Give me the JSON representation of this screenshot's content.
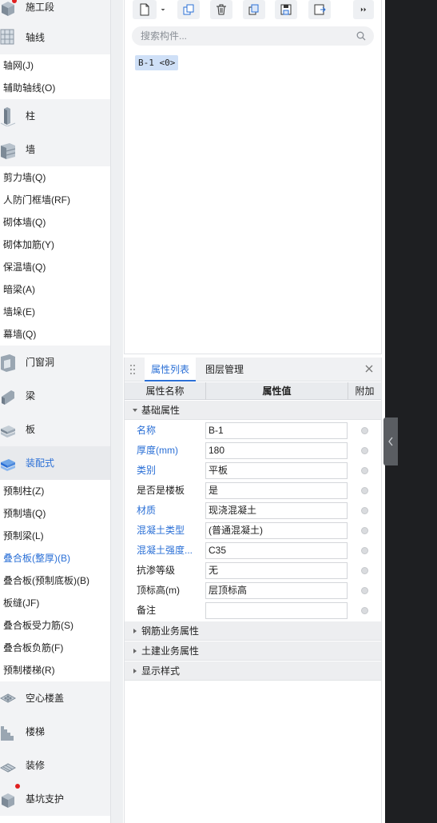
{
  "nav": {
    "cat_shigongduan": "施工段",
    "cat_zhouxian": "轴线",
    "sub_zhouwang": "轴网(J)",
    "sub_fuzhu_zhouxian": "辅助轴线(O)",
    "cat_zhu": "柱",
    "cat_qiang": "墙",
    "sub_jianliqiang": "剪力墙(Q)",
    "sub_renfang": "人防门框墙(RF)",
    "sub_qitiqiang": "砌体墙(Q)",
    "sub_qitijiajin": "砌体加筋(Y)",
    "sub_baowenqiang": "保温墙(Q)",
    "sub_anliang": "暗梁(A)",
    "sub_qiangduo": "墙垛(E)",
    "sub_muqiang": "幕墙(Q)",
    "cat_menchuangdong": "门窗洞",
    "cat_liang": "梁",
    "cat_ban": "板",
    "cat_zhuangpeishi": "装配式",
    "sub_yuzhizhu": "预制柱(Z)",
    "sub_yuzhiqiang": "预制墙(Q)",
    "sub_yuzhiliang": "预制梁(L)",
    "sub_diehe_zhenghou": "叠合板(整厚)(B)",
    "sub_diehe_yuzhi": "叠合板(预制底板)(B)",
    "sub_banfeng": "板缝(JF)",
    "sub_diehe_shouli": "叠合板受力筋(S)",
    "sub_diehe_fujin": "叠合板负筋(F)",
    "sub_yuzhi_louti": "预制楼梯(R)",
    "cat_kongxin": "空心楼盖",
    "cat_louti": "楼梯",
    "cat_zhuangxiu": "装修",
    "cat_jikeng": "基坑支护"
  },
  "component_list": {
    "search_placeholder": "搜索构件...",
    "items": [
      "B-1 <0>"
    ]
  },
  "property_panel": {
    "tab_properties": "属性列表",
    "tab_layers": "图层管理",
    "col_name": "属性名称",
    "col_value": "属性值",
    "col_extra": "附加",
    "group_basic": "基础属性",
    "rows": [
      {
        "name": "名称",
        "value": "B-1"
      },
      {
        "name": "厚度(mm)",
        "value": "180"
      },
      {
        "name": "类别",
        "value": "平板"
      },
      {
        "name": "是否是楼板",
        "value": "是"
      },
      {
        "name": "材质",
        "value": "现浇混凝土"
      },
      {
        "name": "混凝土类型",
        "value": "(普通混凝土)"
      },
      {
        "name": "混凝土强度...",
        "value": "C35"
      },
      {
        "name": "抗渗等级",
        "value": "无"
      },
      {
        "name": "顶标高(m)",
        "value": "层顶标高"
      },
      {
        "name": "备注",
        "value": ""
      }
    ],
    "group_rebar": "钢筋业务属性",
    "group_civil": "土建业务属性",
    "group_display": "显示样式"
  },
  "colors": {
    "accent": "#2a6fd6",
    "tag_bg": "#cfe0f7",
    "notification_dot": "#e02020"
  }
}
